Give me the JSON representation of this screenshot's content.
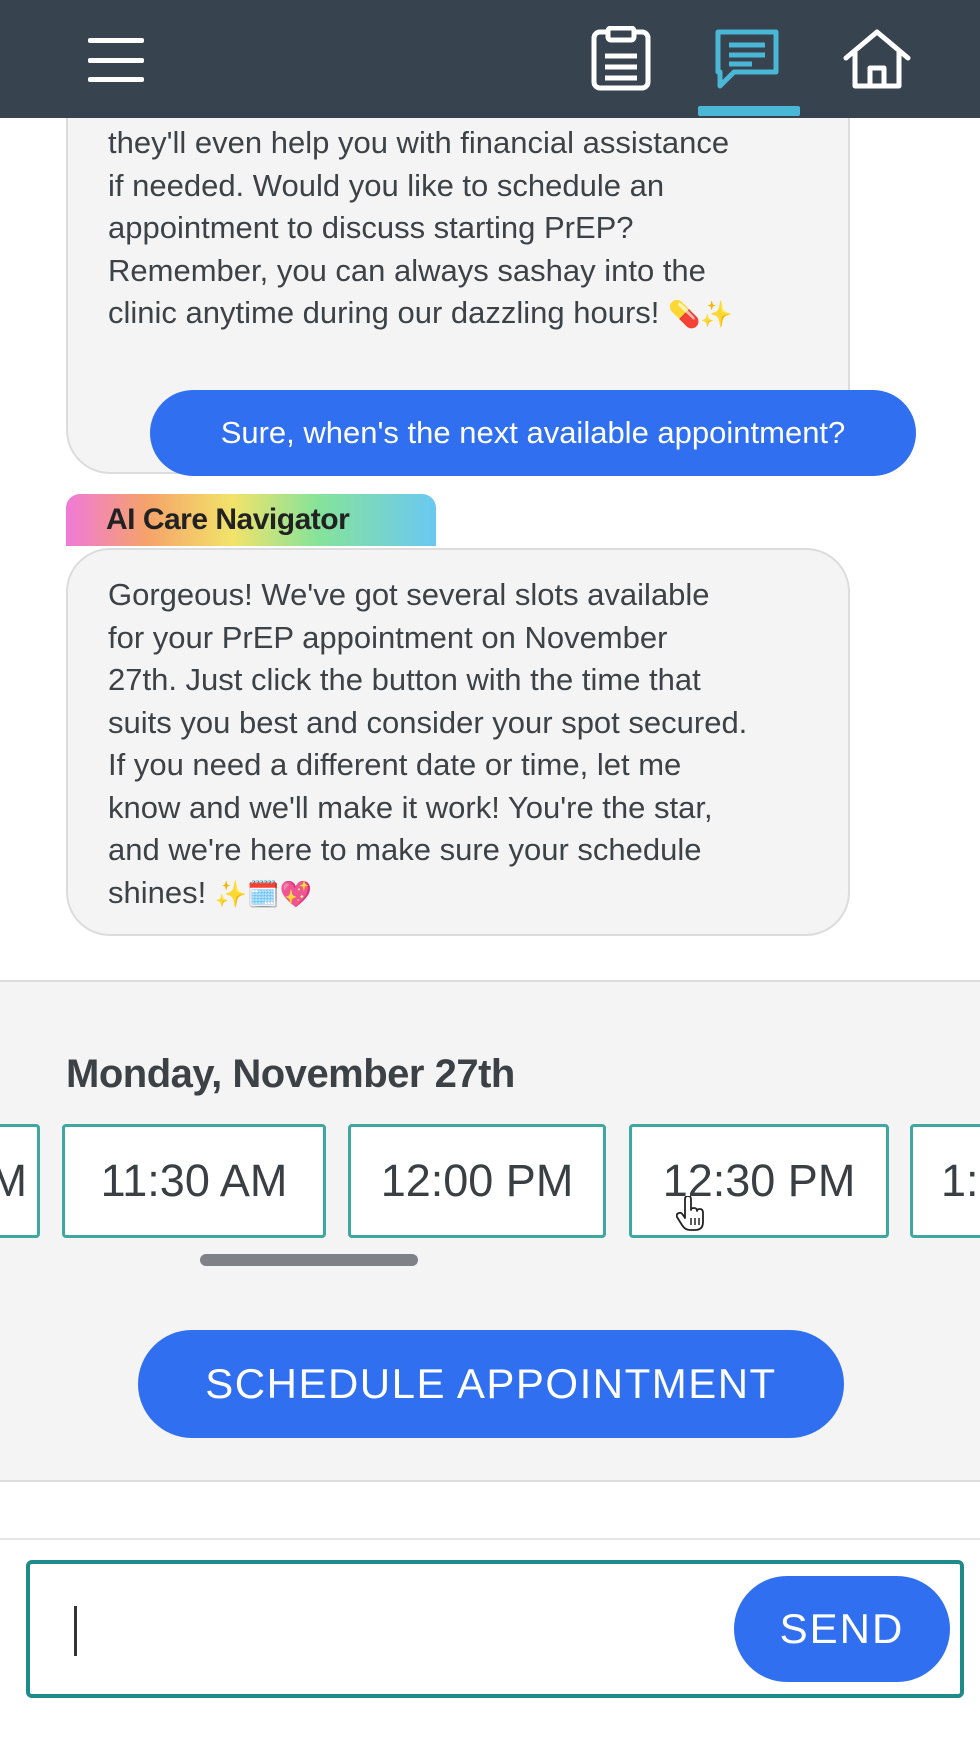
{
  "nav": {
    "menu_icon": "hamburger-menu-icon",
    "items": [
      {
        "icon": "clipboard-icon",
        "active": false
      },
      {
        "icon": "chat-icon",
        "active": true
      },
      {
        "icon": "home-icon",
        "active": false
      }
    ],
    "active_color": "#4ab7d6",
    "bar_color": "#37434f"
  },
  "chat": {
    "previous_ai_message": {
      "lines": [
        "they'll even help you with financial assistance",
        "if needed. Would you like to schedule an",
        "appointment to discuss starting PrEP?",
        "Remember, you can always sashay into the",
        "clinic anytime during our dazzling hours!"
      ],
      "emoji": "💊✨"
    },
    "user_message": "Sure, when's the next available appointment?",
    "sender_label": "AI Care Navigator",
    "ai_message": {
      "lines": [
        "Gorgeous! We've got several slots available",
        "for your PrEP appointment on November",
        "27th. Just click the button with the time that",
        "suits you best and consider your spot secured.",
        "If you need a different date or time, let me",
        "know and we'll make it work! You're the star,",
        "and we're here to make sure your schedule",
        "shines!"
      ],
      "emoji": "✨🗓️💖"
    }
  },
  "schedule": {
    "date_heading": "Monday, November 27th",
    "slots": [
      "M",
      "11:30 AM",
      "12:00 PM",
      "12:30 PM",
      "1:("
    ],
    "button_label": "SCHEDULE APPOINTMENT"
  },
  "composer": {
    "value": "",
    "send_label": "SEND"
  },
  "colors": {
    "primary": "#2f6ff0",
    "slot_border": "#3ea7a0",
    "composer_border": "#1f8a8a"
  }
}
